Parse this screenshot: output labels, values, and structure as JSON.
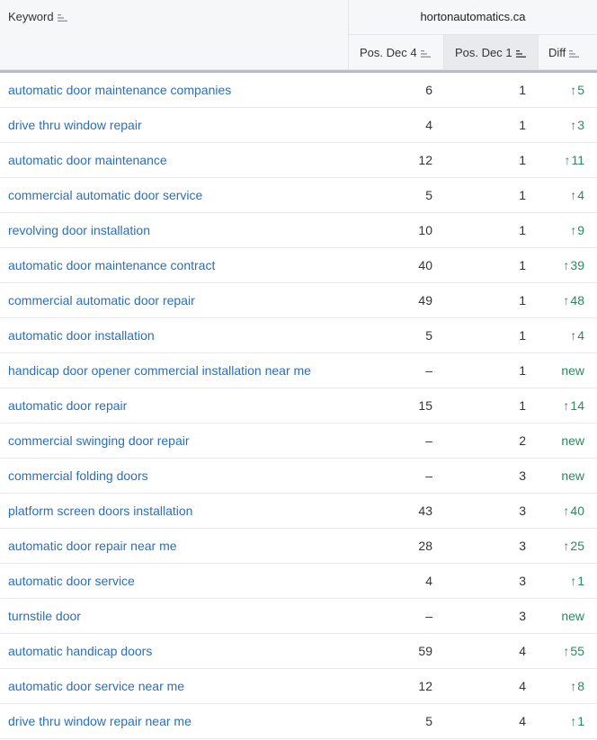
{
  "header": {
    "keyword_label": "Keyword",
    "domain": "hortonautomatics.ca",
    "col_prev": "Pos. Dec 4",
    "col_curr": "Pos. Dec 1",
    "col_diff": "Diff"
  },
  "colors": {
    "link": "#2b6fb5",
    "positive": "#2a8a5c",
    "active_header": "#e9eaee"
  },
  "rows": [
    {
      "keyword": "automatic door maintenance companies",
      "prev": "6",
      "curr": "1",
      "diff": "5",
      "arrow": "↑"
    },
    {
      "keyword": "drive thru window repair",
      "prev": "4",
      "curr": "1",
      "diff": "3",
      "arrow": "↑"
    },
    {
      "keyword": "automatic door maintenance",
      "prev": "12",
      "curr": "1",
      "diff": "11",
      "arrow": "↑"
    },
    {
      "keyword": "commercial automatic door service",
      "prev": "5",
      "curr": "1",
      "diff": "4",
      "arrow": "↑"
    },
    {
      "keyword": "revolving door installation",
      "prev": "10",
      "curr": "1",
      "diff": "9",
      "arrow": "↑"
    },
    {
      "keyword": "automatic door maintenance contract",
      "prev": "40",
      "curr": "1",
      "diff": "39",
      "arrow": "↑"
    },
    {
      "keyword": "commercial automatic door repair",
      "prev": "49",
      "curr": "1",
      "diff": "48",
      "arrow": "↑"
    },
    {
      "keyword": "automatic door installation",
      "prev": "5",
      "curr": "1",
      "diff": "4",
      "arrow": "↑"
    },
    {
      "keyword": "handicap door opener commercial installation near me",
      "prev": "–",
      "curr": "1",
      "diff": "new",
      "arrow": ""
    },
    {
      "keyword": "automatic door repair",
      "prev": "15",
      "curr": "1",
      "diff": "14",
      "arrow": "↑"
    },
    {
      "keyword": "commercial swinging door repair",
      "prev": "–",
      "curr": "2",
      "diff": "new",
      "arrow": ""
    },
    {
      "keyword": "commercial folding doors",
      "prev": "–",
      "curr": "3",
      "diff": "new",
      "arrow": ""
    },
    {
      "keyword": "platform screen doors installation",
      "prev": "43",
      "curr": "3",
      "diff": "40",
      "arrow": "↑"
    },
    {
      "keyword": "automatic door repair near me",
      "prev": "28",
      "curr": "3",
      "diff": "25",
      "arrow": "↑"
    },
    {
      "keyword": "automatic door service",
      "prev": "4",
      "curr": "3",
      "diff": "1",
      "arrow": "↑"
    },
    {
      "keyword": "turnstile door",
      "prev": "–",
      "curr": "3",
      "diff": "new",
      "arrow": ""
    },
    {
      "keyword": "automatic handicap doors",
      "prev": "59",
      "curr": "4",
      "diff": "55",
      "arrow": "↑"
    },
    {
      "keyword": "automatic door service near me",
      "prev": "12",
      "curr": "4",
      "diff": "8",
      "arrow": "↑"
    },
    {
      "keyword": "drive thru window repair near me",
      "prev": "5",
      "curr": "4",
      "diff": "1",
      "arrow": "↑"
    }
  ]
}
